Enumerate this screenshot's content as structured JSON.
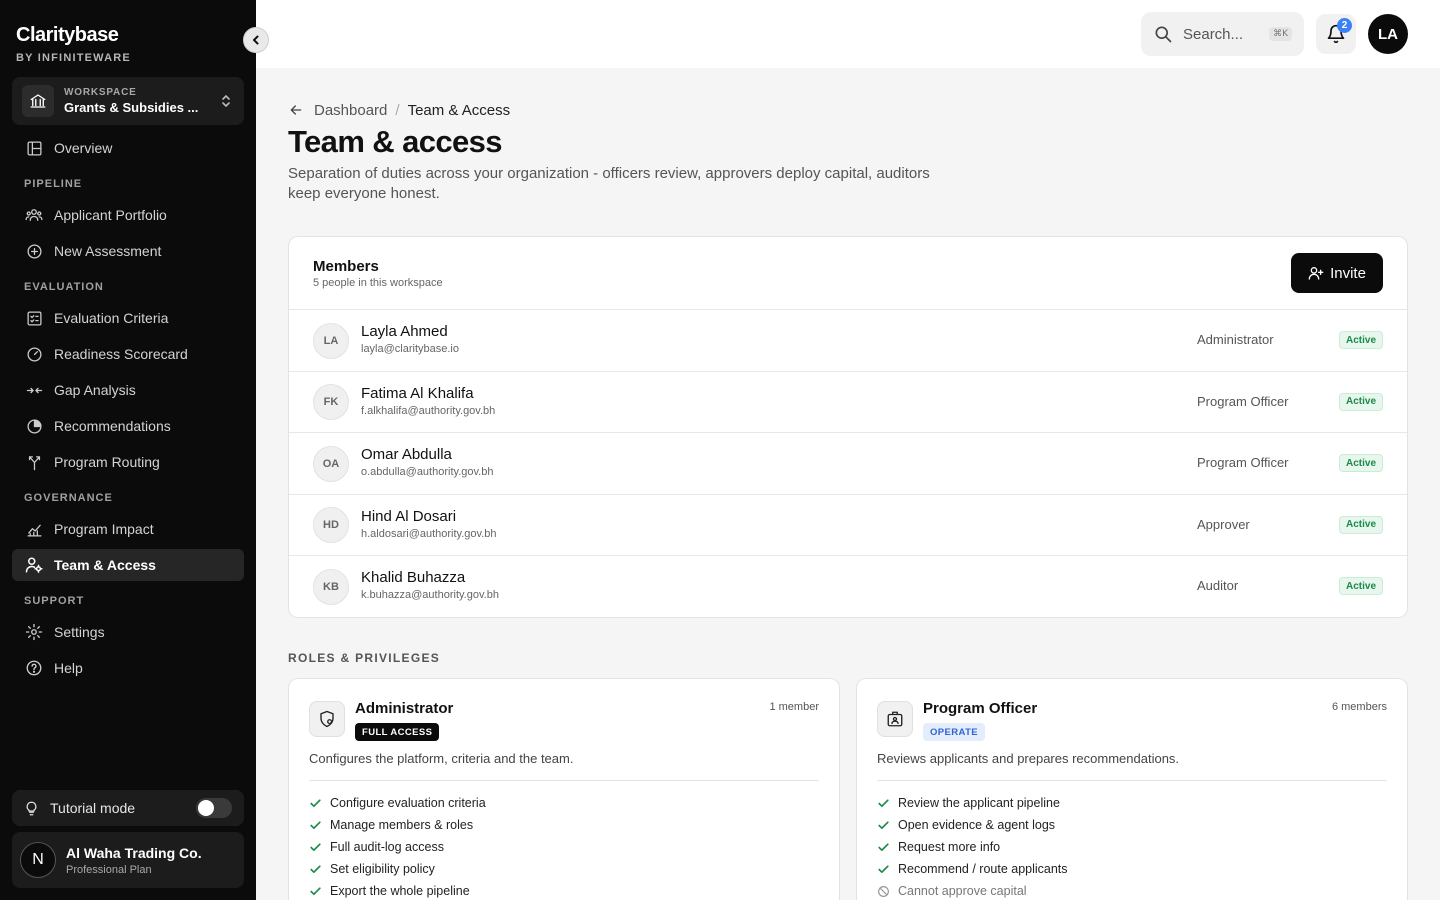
{
  "brand": {
    "name": "Claritybase",
    "sub": "BY INFINITEWARE"
  },
  "workspace": {
    "label": "WORKSPACE",
    "name": "Grants & Subsidies ..."
  },
  "nav": {
    "overview": "Overview",
    "section_pipeline": "PIPELINE",
    "applicant_portfolio": "Applicant Portfolio",
    "new_assessment": "New Assessment",
    "section_evaluation": "EVALUATION",
    "evaluation_criteria": "Evaluation Criteria",
    "readiness_scorecard": "Readiness Scorecard",
    "gap_analysis": "Gap Analysis",
    "recommendations": "Recommendations",
    "program_routing": "Program Routing",
    "section_governance": "GOVERNANCE",
    "program_impact": "Program Impact",
    "team_access": "Team & Access",
    "section_support": "SUPPORT",
    "settings": "Settings",
    "help": "Help"
  },
  "tutorial": {
    "label": "Tutorial mode"
  },
  "org": {
    "initial": "N",
    "name": "Al Waha Trading Co.",
    "plan": "Professional Plan"
  },
  "topbar": {
    "search_placeholder": "Search...",
    "search_shortcut": "⌘K",
    "notifications_count": "2",
    "user_initials": "LA"
  },
  "breadcrumb": {
    "parent": "Dashboard",
    "separator": "/",
    "current": "Team & Access"
  },
  "page": {
    "title": "Team & access",
    "description": "Separation of duties across your organization - officers review, approvers deploy capital, auditors keep everyone honest."
  },
  "members": {
    "title": "Members",
    "subtitle": "5 people in this workspace",
    "invite_label": "Invite",
    "rows": [
      {
        "initials": "LA",
        "name": "Layla Ahmed",
        "email": "layla@claritybase.io",
        "role": "Administrator",
        "status": "Active"
      },
      {
        "initials": "FK",
        "name": "Fatima Al Khalifa",
        "email": "f.alkhalifa@authority.gov.bh",
        "role": "Program Officer",
        "status": "Active"
      },
      {
        "initials": "OA",
        "name": "Omar Abdulla",
        "email": "o.abdulla@authority.gov.bh",
        "role": "Program Officer",
        "status": "Active"
      },
      {
        "initials": "HD",
        "name": "Hind Al Dosari",
        "email": "h.aldosari@authority.gov.bh",
        "role": "Approver",
        "status": "Active"
      },
      {
        "initials": "KB",
        "name": "Khalid Buhazza",
        "email": "k.buhazza@authority.gov.bh",
        "role": "Auditor",
        "status": "Active"
      }
    ]
  },
  "roles": {
    "section_label": "ROLES & PRIVILEGES",
    "cards": [
      {
        "name": "Administrator",
        "badge": "FULL ACCESS",
        "count": "1 member",
        "description": "Configures the platform, criteria and the team.",
        "permissions": [
          "Configure evaluation criteria",
          "Manage members & roles",
          "Full audit-log access",
          "Set eligibility policy",
          "Export the whole pipeline"
        ]
      },
      {
        "name": "Program Officer",
        "badge": "OPERATE",
        "count": "6 members",
        "description": "Reviews applicants and prepares recommendations.",
        "permissions": [
          "Review the applicant pipeline",
          "Open evidence & agent logs",
          "Request more info",
          "Recommend / route applicants"
        ],
        "denied": [
          "Cannot approve capital"
        ]
      }
    ]
  },
  "colors": {
    "sidebar_bg": "#0b0b0b",
    "accent_blue": "#3b82f6",
    "status_green": "#1b8a4a"
  }
}
